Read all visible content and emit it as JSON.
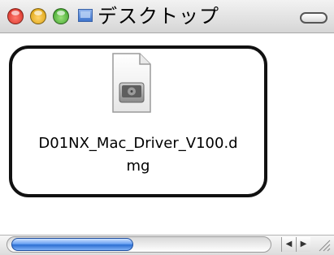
{
  "window": {
    "title": "デスクトップ"
  },
  "items": [
    {
      "filename": "D01NX_Mac_Driver_V100.d\nmg",
      "icon": "disk-image-icon",
      "selected": true
    }
  ],
  "scrollbar": {
    "left_arrow": "◀",
    "right_arrow": "▶"
  },
  "colors": {
    "selection_border": "#111111",
    "scroll_thumb": "#2d6fd2",
    "close": "#d1261b",
    "minimize": "#d59a00",
    "maximize": "#2f9b1e"
  }
}
